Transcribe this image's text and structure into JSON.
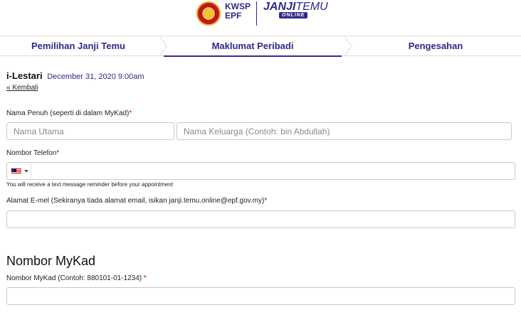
{
  "header": {
    "kwsp_line1": "KWSP",
    "kwsp_line2": "EPF",
    "janji_main": "JANJI",
    "janji_rest": "TEMU",
    "online": "ONLINE"
  },
  "steps": [
    {
      "label": "Pemilihan Janji Temu"
    },
    {
      "label": "Maklumat Peribadi"
    },
    {
      "label": "Pengesahan"
    }
  ],
  "appointment": {
    "title": "i-Lestari",
    "date": "December 31, 2020 9:00am",
    "back_link": "« Kembali"
  },
  "form": {
    "name_label": "Nama Penuh (seperti di dalam MyKad)",
    "first_name_placeholder": "Nama Utama",
    "last_name_placeholder": "Nama Keluarga (Contoh: bin Abdullah)",
    "phone_label": "Nombor Telefon",
    "phone_value": "",
    "phone_helper": "You will receive a text message reminder before your appointment",
    "email_label": "Alamat E-mel (Sekiranya tiada alamat email, isikan janji.temu.online@epf.gov.my)",
    "email_value": "",
    "mykad_heading": "Nombor MyKad",
    "mykad_label": "Nombor MyKad (Contoh: 880101-01-1234) ",
    "mykad_value": "",
    "required_mark": "*"
  },
  "colors": {
    "brand": "#2d2a8c",
    "required": "#cc0000"
  }
}
